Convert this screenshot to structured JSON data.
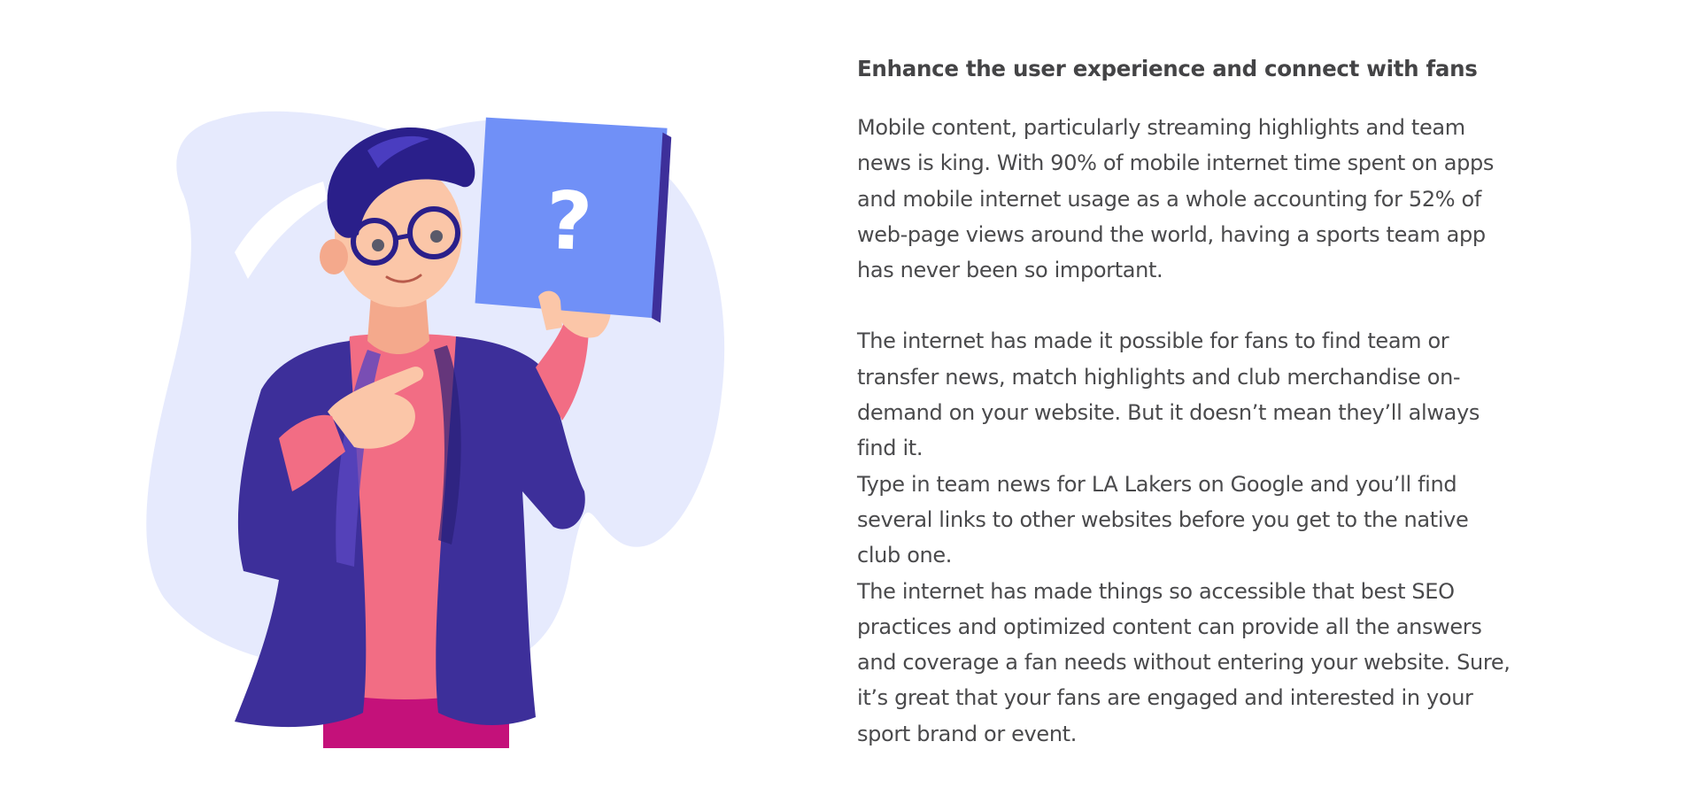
{
  "illustration": {
    "card_symbol": "?",
    "colors": {
      "blob": "#e6eafd",
      "card": "#7090f7",
      "jacket": "#3d2f9a",
      "shirt": "#f26d84",
      "hair": "#2a1f8a",
      "skin": "#fbc6a8",
      "pants": "#c4117a"
    }
  },
  "content": {
    "heading": "Enhance the user experience and connect with fans",
    "paragraphs": [
      "Mobile content, particularly streaming highlights and team news is king. With 90% of mobile internet time spent on apps and mobile internet usage as a whole accounting for 52% of web-page views around the world, having a sports team app has never been so important.",
      "The internet has made it possible for fans to find team or transfer news, match highlights and club merchandise on-demand on your website. But it doesn’t mean they’ll always find it.",
      "Type in team news for LA Lakers on Google and you’ll find several links to other websites before you get to the native club one.",
      "The internet has made things so accessible that best SEO practices and optimized content can provide all the answers and coverage a fan needs without entering your website. Sure, it’s great that your fans are engaged and interested in your sport brand or event."
    ]
  }
}
